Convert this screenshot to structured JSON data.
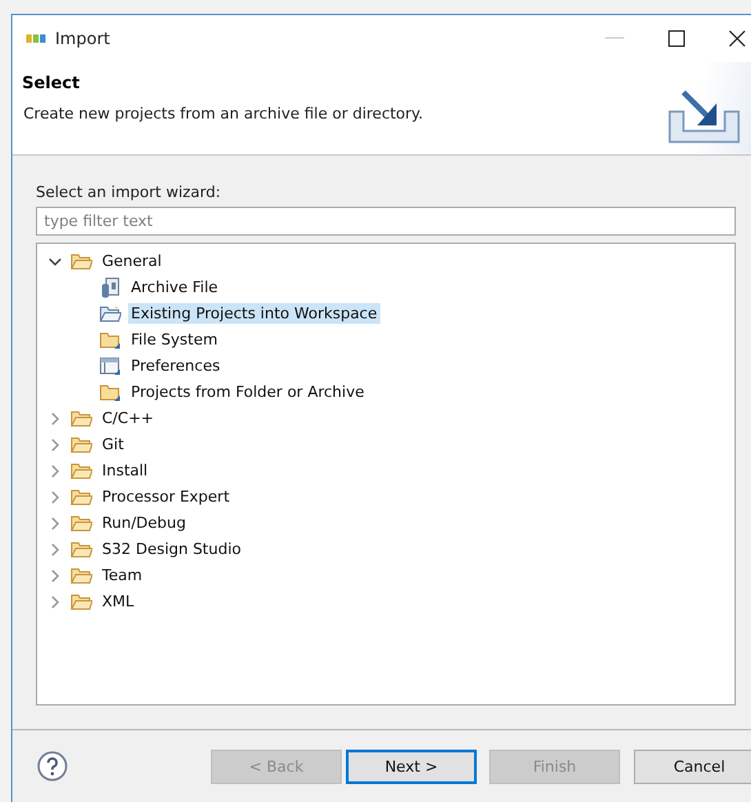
{
  "window": {
    "title": "Import"
  },
  "header": {
    "title": "Select",
    "description": "Create new projects from an archive file or directory."
  },
  "wizard_label": "Select an import wizard:",
  "filter": {
    "placeholder": "type filter text"
  },
  "tree": [
    {
      "label": "General",
      "expanded": true,
      "selected": false,
      "children": [
        {
          "label": "Archive File",
          "kind": "archive",
          "selected": false
        },
        {
          "label": "Existing Projects into Workspace",
          "kind": "project",
          "selected": true
        },
        {
          "label": "File System",
          "kind": "folder",
          "selected": false
        },
        {
          "label": "Preferences",
          "kind": "preferences",
          "selected": false
        },
        {
          "label": "Projects from Folder or Archive",
          "kind": "folder",
          "selected": false
        }
      ]
    },
    {
      "label": "C/C++",
      "expanded": false,
      "selected": false
    },
    {
      "label": "Git",
      "expanded": false,
      "selected": false
    },
    {
      "label": "Install",
      "expanded": false,
      "selected": false
    },
    {
      "label": "Processor Expert",
      "expanded": false,
      "selected": false
    },
    {
      "label": "Run/Debug",
      "expanded": false,
      "selected": false
    },
    {
      "label": "S32 Design Studio",
      "expanded": false,
      "selected": false
    },
    {
      "label": "Team",
      "expanded": false,
      "selected": false
    },
    {
      "label": "XML",
      "expanded": false,
      "selected": false
    }
  ],
  "buttons": [
    {
      "label": "< Back",
      "disabled": true,
      "default": false
    },
    {
      "label": "Next >",
      "disabled": false,
      "default": true
    },
    {
      "label": "Finish",
      "disabled": true,
      "default": false
    },
    {
      "label": "Cancel",
      "disabled": false,
      "default": false
    }
  ]
}
